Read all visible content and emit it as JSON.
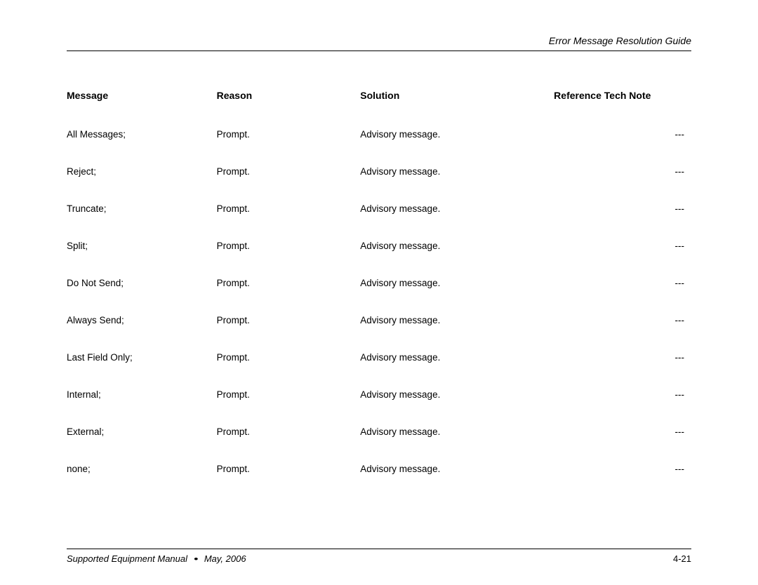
{
  "header": {
    "title": "Error Message Resolution Guide"
  },
  "table": {
    "headers": {
      "message": "Message",
      "reason": "Reason",
      "solution": "Solution",
      "reference": "Reference Tech Note"
    },
    "rows": [
      {
        "message": "All Messages;",
        "reason": "Prompt.",
        "solution": "Advisory message.",
        "reference": "---"
      },
      {
        "message": "Reject;",
        "reason": "Prompt.",
        "solution": "Advisory message.",
        "reference": "---"
      },
      {
        "message": "Truncate;",
        "reason": "Prompt.",
        "solution": "Advisory message.",
        "reference": "---"
      },
      {
        "message": "Split;",
        "reason": "Prompt.",
        "solution": "Advisory message.",
        "reference": "---"
      },
      {
        "message": "Do Not Send;",
        "reason": "Prompt.",
        "solution": "Advisory message.",
        "reference": "---"
      },
      {
        "message": "Always Send;",
        "reason": "Prompt.",
        "solution": "Advisory message.",
        "reference": "---"
      },
      {
        "message": "Last Field Only;",
        "reason": "Prompt.",
        "solution": "Advisory message.",
        "reference": "---"
      },
      {
        "message": "Internal;",
        "reason": "Prompt.",
        "solution": "Advisory message.",
        "reference": "---"
      },
      {
        "message": "External;",
        "reason": "Prompt.",
        "solution": "Advisory message.",
        "reference": "---"
      },
      {
        "message": "none;",
        "reason": "Prompt.",
        "solution": "Advisory message.",
        "reference": "---"
      }
    ]
  },
  "footer": {
    "manual": "Supported Equipment Manual",
    "separator": "•",
    "date": "May, 2006",
    "page": "4-21"
  }
}
